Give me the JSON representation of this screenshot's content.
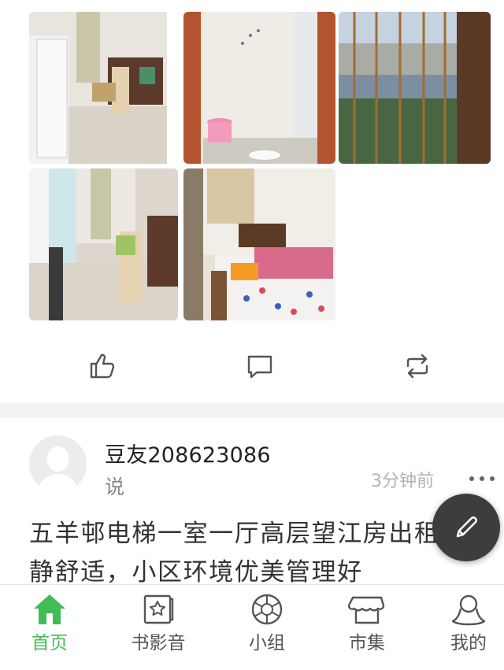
{
  "photos": [
    {
      "desc": "living-room"
    },
    {
      "desc": "bathroom"
    },
    {
      "desc": "river-view"
    },
    {
      "desc": "living-room-2"
    },
    {
      "desc": "bedroom"
    }
  ],
  "actions": {
    "like_icon": "thumbs-up-icon",
    "comment_icon": "comment-icon",
    "share_icon": "repost-icon"
  },
  "post": {
    "username": "豆友208623086",
    "action": "说",
    "time": "3分钟前",
    "text": "五羊邨电梯一室一厅高层望江房出租，安静舒适，小区环境优美管理好"
  },
  "fab_icon": "pencil-icon",
  "nav": {
    "items": [
      {
        "label": "首页",
        "icon": "home-icon",
        "active": true
      },
      {
        "label": "书影音",
        "icon": "book-movie-music-icon",
        "active": false
      },
      {
        "label": "小组",
        "icon": "group-icon",
        "active": false
      },
      {
        "label": "市集",
        "icon": "market-icon",
        "active": false
      },
      {
        "label": "我的",
        "icon": "profile-icon",
        "active": false
      }
    ]
  },
  "colors": {
    "accent": "#42bd56",
    "fab": "#3d3d3d",
    "divider": "#f3f3f3"
  }
}
